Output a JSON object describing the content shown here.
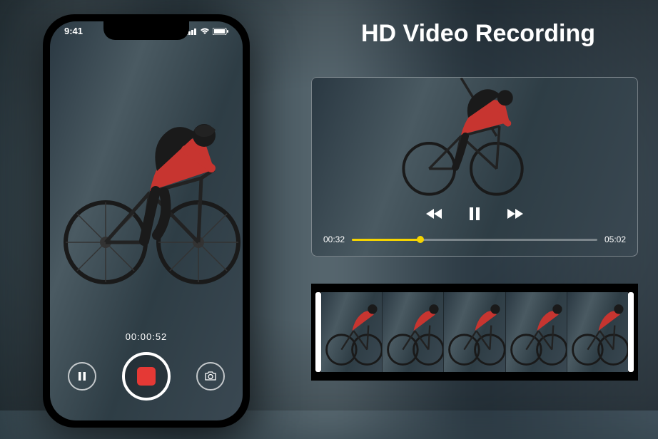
{
  "heading": "HD Video Recording",
  "phone": {
    "time": "9:41",
    "rec_timer": "00:00:52"
  },
  "player": {
    "current_time": "00:32",
    "total_time": "05:02"
  }
}
